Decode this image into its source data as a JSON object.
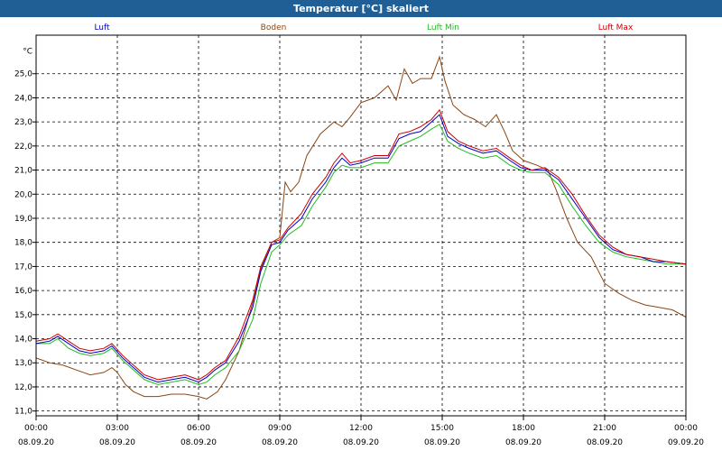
{
  "title": "Temperatur [°C] skaliert",
  "chart_data": {
    "type": "line",
    "title": "Temperatur [°C] skaliert",
    "ylabel": "°C",
    "ylim": [
      10.8,
      26.6
    ],
    "xlim": [
      0,
      24
    ],
    "y_ticks": [
      11.0,
      12.0,
      13.0,
      14.0,
      15.0,
      16.0,
      17.0,
      18.0,
      19.0,
      20.0,
      21.0,
      22.0,
      23.0,
      24.0,
      25.0
    ],
    "y_tick_labels": [
      "11,0",
      "12,0",
      "13,0",
      "14,0",
      "15,0",
      "16,0",
      "17,0",
      "18,0",
      "19,0",
      "20,0",
      "21,0",
      "22,0",
      "23,0",
      "24,0",
      "25,0"
    ],
    "x_ticks": [
      {
        "time": "00:00",
        "date": "08.09.20"
      },
      {
        "time": "03:00",
        "date": "08.09.20"
      },
      {
        "time": "06:00",
        "date": "08.09.20"
      },
      {
        "time": "09:00",
        "date": "08.09.20"
      },
      {
        "time": "12:00",
        "date": "08.09.20"
      },
      {
        "time": "15:00",
        "date": "08.09.20"
      },
      {
        "time": "18:00",
        "date": "08.09.20"
      },
      {
        "time": "21:00",
        "date": "08.09.20"
      },
      {
        "time": "00:00",
        "date": "09.09.20"
      }
    ],
    "grid": true,
    "legend_position": "top",
    "series": [
      {
        "name": "Luft",
        "color": "#0000cc",
        "x": [
          0,
          0.5,
          0.8,
          1.2,
          1.6,
          2.0,
          2.5,
          2.8,
          3.2,
          3.6,
          4.0,
          4.5,
          5.0,
          5.5,
          6.0,
          6.3,
          6.6,
          7.0,
          7.5,
          8.0,
          8.3,
          8.7,
          9.0,
          9.3,
          9.8,
          10.2,
          10.7,
          11.0,
          11.3,
          11.6,
          12.0,
          12.5,
          13.0,
          13.4,
          13.8,
          14.2,
          14.6,
          14.9,
          15.2,
          15.6,
          16.0,
          16.5,
          17.0,
          17.5,
          17.9,
          18.3,
          18.8,
          19.3,
          19.8,
          20.3,
          20.8,
          21.3,
          21.8,
          22.3,
          22.8,
          23.3,
          24.0
        ],
        "values": [
          13.8,
          13.9,
          14.1,
          13.8,
          13.5,
          13.4,
          13.5,
          13.7,
          13.2,
          12.8,
          12.4,
          12.2,
          12.3,
          12.4,
          12.2,
          12.4,
          12.7,
          13.0,
          13.9,
          15.3,
          16.8,
          17.9,
          18.0,
          18.5,
          19.0,
          19.8,
          20.5,
          21.1,
          21.5,
          21.2,
          21.3,
          21.5,
          21.5,
          22.3,
          22.5,
          22.6,
          23.0,
          23.3,
          22.4,
          22.1,
          21.9,
          21.7,
          21.8,
          21.4,
          21.1,
          21.0,
          21.0,
          20.6,
          19.8,
          19.0,
          18.2,
          17.7,
          17.5,
          17.4,
          17.2,
          17.2,
          17.1
        ]
      },
      {
        "name": "Boden",
        "color": "#8b4513",
        "x": [
          0,
          0.5,
          1.0,
          1.5,
          2.0,
          2.5,
          2.8,
          3.0,
          3.3,
          3.6,
          4.0,
          4.5,
          5.0,
          5.5,
          6.0,
          6.3,
          6.7,
          7.0,
          7.5,
          8.0,
          8.3,
          8.7,
          9.0,
          9.2,
          9.4,
          9.7,
          10.0,
          10.5,
          11.0,
          11.3,
          11.6,
          12.0,
          12.5,
          13.0,
          13.3,
          13.6,
          13.9,
          14.2,
          14.6,
          14.9,
          15.1,
          15.4,
          15.8,
          16.2,
          16.6,
          17.0,
          17.3,
          17.6,
          18.0,
          18.5,
          18.9,
          19.2,
          19.6,
          20.0,
          20.5,
          21.0,
          21.5,
          22.0,
          22.5,
          23.0,
          23.5,
          24.0
        ],
        "values": [
          13.2,
          13.0,
          12.9,
          12.7,
          12.5,
          12.6,
          12.8,
          12.6,
          12.1,
          11.8,
          11.6,
          11.6,
          11.7,
          11.7,
          11.6,
          11.5,
          11.8,
          12.3,
          13.5,
          15.5,
          16.9,
          18.0,
          18.2,
          20.5,
          20.1,
          20.5,
          21.6,
          22.5,
          23.0,
          22.8,
          23.2,
          23.8,
          24.0,
          24.5,
          23.9,
          25.2,
          24.6,
          24.8,
          24.8,
          25.7,
          24.7,
          23.7,
          23.3,
          23.1,
          22.8,
          23.3,
          22.6,
          21.8,
          21.4,
          21.2,
          21.0,
          20.2,
          19.0,
          18.0,
          17.4,
          16.3,
          15.9,
          15.6,
          15.4,
          15.3,
          15.2,
          14.9
        ]
      },
      {
        "name": "Luft Min",
        "color": "#22bb22",
        "x": [
          0,
          0.5,
          0.8,
          1.2,
          1.6,
          2.0,
          2.5,
          2.8,
          3.2,
          3.6,
          4.0,
          4.5,
          5.0,
          5.5,
          6.0,
          6.3,
          6.6,
          7.0,
          7.5,
          8.0,
          8.3,
          8.7,
          9.0,
          9.3,
          9.8,
          10.2,
          10.7,
          11.0,
          11.3,
          11.6,
          12.0,
          12.5,
          13.0,
          13.4,
          13.8,
          14.2,
          14.6,
          14.9,
          15.2,
          15.6,
          16.0,
          16.5,
          17.0,
          17.5,
          17.9,
          18.3,
          18.8,
          19.3,
          19.8,
          20.3,
          20.8,
          21.3,
          21.8,
          22.3,
          22.8,
          23.3,
          24.0
        ],
        "values": [
          13.8,
          13.8,
          14.0,
          13.6,
          13.4,
          13.3,
          13.4,
          13.6,
          13.1,
          12.7,
          12.3,
          12.1,
          12.2,
          12.3,
          12.1,
          12.2,
          12.5,
          12.8,
          13.5,
          14.8,
          16.3,
          17.6,
          17.9,
          18.3,
          18.7,
          19.5,
          20.3,
          20.9,
          21.2,
          21.1,
          21.1,
          21.3,
          21.3,
          22.0,
          22.2,
          22.4,
          22.7,
          22.9,
          22.2,
          21.9,
          21.7,
          21.5,
          21.6,
          21.2,
          21.0,
          20.9,
          20.9,
          20.4,
          19.5,
          18.7,
          18.0,
          17.6,
          17.4,
          17.3,
          17.2,
          17.1,
          17.1
        ]
      },
      {
        "name": "Luft Max",
        "color": "#cc0000",
        "x": [
          0,
          0.5,
          0.8,
          1.2,
          1.6,
          2.0,
          2.5,
          2.8,
          3.2,
          3.6,
          4.0,
          4.5,
          5.0,
          5.5,
          6.0,
          6.3,
          6.6,
          7.0,
          7.5,
          8.0,
          8.3,
          8.7,
          9.0,
          9.3,
          9.8,
          10.2,
          10.7,
          11.0,
          11.3,
          11.6,
          12.0,
          12.5,
          13.0,
          13.4,
          13.8,
          14.2,
          14.6,
          14.9,
          15.2,
          15.6,
          16.0,
          16.5,
          17.0,
          17.5,
          17.9,
          18.3,
          18.8,
          19.3,
          19.8,
          20.3,
          20.8,
          21.3,
          21.8,
          22.3,
          22.8,
          23.3,
          24.0
        ],
        "values": [
          13.9,
          14.0,
          14.2,
          13.9,
          13.6,
          13.5,
          13.6,
          13.8,
          13.3,
          12.9,
          12.5,
          12.3,
          12.4,
          12.5,
          12.3,
          12.5,
          12.8,
          13.1,
          14.1,
          15.6,
          17.0,
          18.0,
          18.1,
          18.6,
          19.2,
          20.0,
          20.7,
          21.3,
          21.7,
          21.3,
          21.4,
          21.6,
          21.6,
          22.5,
          22.6,
          22.8,
          23.1,
          23.5,
          22.6,
          22.2,
          22.0,
          21.8,
          21.9,
          21.5,
          21.2,
          21.0,
          21.1,
          20.7,
          20.0,
          19.1,
          18.3,
          17.8,
          17.5,
          17.4,
          17.3,
          17.2,
          17.1
        ]
      }
    ]
  }
}
